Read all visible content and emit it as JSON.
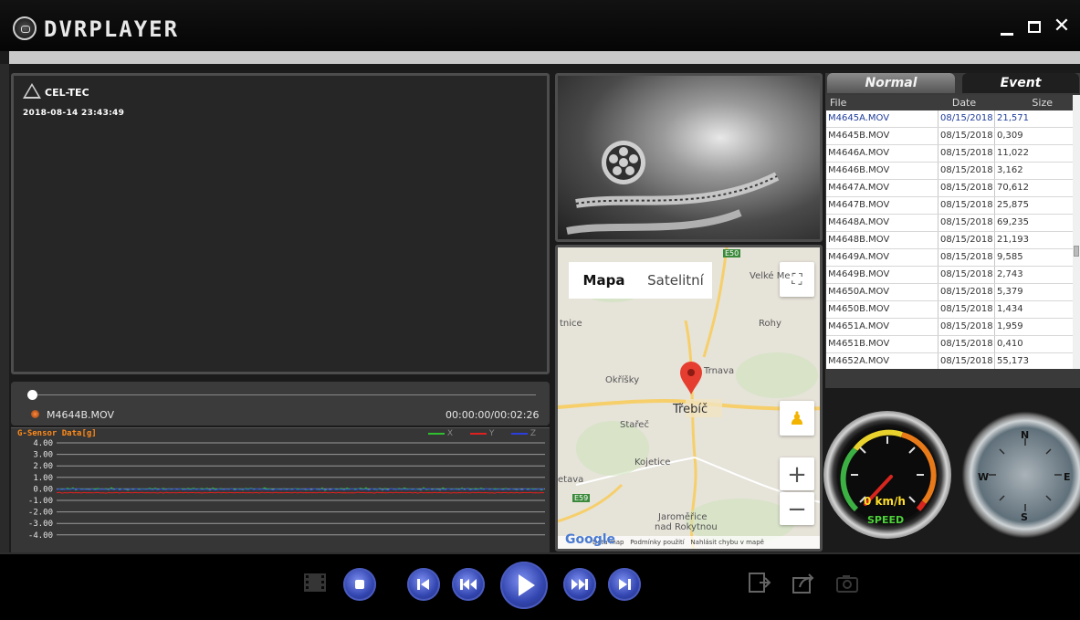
{
  "window": {
    "title": "DVRPLAYER",
    "minimize_label": "",
    "maximize_label": "",
    "close_label": "✕"
  },
  "video": {
    "brand": "CEL-TEC",
    "overlay_timestamp": "2018-08-14 23:43:49"
  },
  "playback": {
    "current_file": "M4644B.MOV",
    "time": "00:00:00/00:02:26",
    "progress": 0
  },
  "gsensor": {
    "title": "G-Sensor Data[g]",
    "y_ticks": [
      "4.00",
      "3.00",
      "2.00",
      "1.00",
      "0.00",
      "-1.00",
      "-2.00",
      "-3.00",
      "-4.00"
    ],
    "legend": [
      {
        "name": "X",
        "color": "#2fbf2f"
      },
      {
        "name": "Y",
        "color": "#e02020"
      },
      {
        "name": "Z",
        "color": "#2b3fe0"
      }
    ]
  },
  "map": {
    "tabs": [
      "Mapa",
      "Satelitní"
    ],
    "places": [
      {
        "name": "Velké Me"
      },
      {
        "name": "Rohy"
      },
      {
        "name": "tnice"
      },
      {
        "name": "Okříšky"
      },
      {
        "name": "Trnava"
      },
      {
        "name": "Třebíč"
      },
      {
        "name": "Stařeč"
      },
      {
        "name": "Kojetice"
      },
      {
        "name": "etava"
      },
      {
        "name": "Jaroměřice"
      },
      {
        "name": "nad Rokytnou"
      }
    ],
    "road_labels": [
      "E50",
      "E59"
    ],
    "footer": [
      "Data map",
      "Podmínky použití",
      "Nahlásit chybu v mapě"
    ],
    "google": "Google"
  },
  "filelist": {
    "tabs": [
      "Normal",
      "Event"
    ],
    "columns": [
      "File",
      "Date",
      "Size"
    ],
    "rows": [
      {
        "file": "M4645A.MOV",
        "date": "08/15/2018",
        "size": "21,571"
      },
      {
        "file": "M4645B.MOV",
        "date": "08/15/2018",
        "size": "0,309"
      },
      {
        "file": "M4646A.MOV",
        "date": "08/15/2018",
        "size": "11,022"
      },
      {
        "file": "M4646B.MOV",
        "date": "08/15/2018",
        "size": "3,162"
      },
      {
        "file": "M4647A.MOV",
        "date": "08/15/2018",
        "size": "70,612"
      },
      {
        "file": "M4647B.MOV",
        "date": "08/15/2018",
        "size": "25,875"
      },
      {
        "file": "M4648A.MOV",
        "date": "08/15/2018",
        "size": "69,235"
      },
      {
        "file": "M4648B.MOV",
        "date": "08/15/2018",
        "size": "21,193"
      },
      {
        "file": "M4649A.MOV",
        "date": "08/15/2018",
        "size": "9,585"
      },
      {
        "file": "M4649B.MOV",
        "date": "08/15/2018",
        "size": "2,743"
      },
      {
        "file": "M4650A.MOV",
        "date": "08/15/2018",
        "size": "5,379"
      },
      {
        "file": "M4650B.MOV",
        "date": "08/15/2018",
        "size": "1,434"
      },
      {
        "file": "M4651A.MOV",
        "date": "08/15/2018",
        "size": "1,959"
      },
      {
        "file": "M4651B.MOV",
        "date": "08/15/2018",
        "size": "0,410"
      },
      {
        "file": "M4652A.MOV",
        "date": "08/15/2018",
        "size": "55,173"
      }
    ]
  },
  "gauges": {
    "speed_value": "0 km/h",
    "speed_label": "SPEED",
    "compass": [
      "N",
      "E",
      "S",
      "W"
    ]
  },
  "controls": {
    "icons": [
      "film-icon",
      "stop-icon",
      "previous-file-icon",
      "rewind-icon",
      "play-icon",
      "fast-forward-icon",
      "next-file-icon",
      "export-icon",
      "share-icon",
      "snapshot-icon"
    ]
  }
}
